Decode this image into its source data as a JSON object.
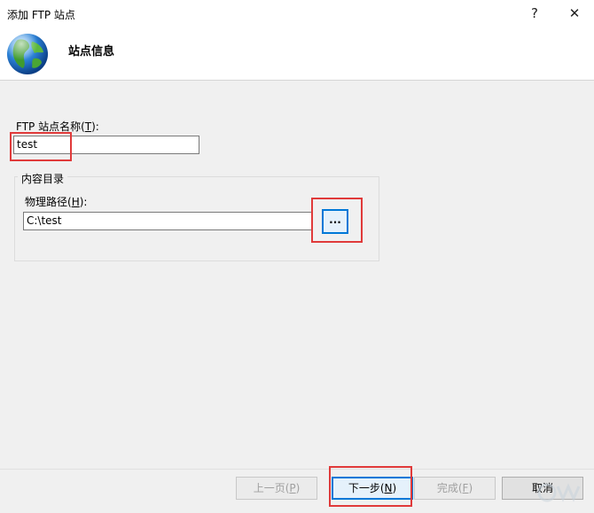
{
  "window": {
    "title": "添加 FTP 站点",
    "help_glyph": "?",
    "close_glyph": "✕"
  },
  "header": {
    "title": "站点信息",
    "icon": "globe-icon"
  },
  "site_name": {
    "label_prefix": "FTP 站点名称(",
    "label_key": "T",
    "label_suffix": "):",
    "value": "test"
  },
  "content_directory": {
    "group_label": "内容目录",
    "path_label_prefix": "物理路径(",
    "path_label_key": "H",
    "path_label_suffix": "):",
    "path_value": "C:\\test",
    "browse_label": "..."
  },
  "footer": {
    "prev": {
      "text": "上一页(",
      "key": "P",
      "end": ")"
    },
    "next": {
      "text": "下一步(",
      "key": "N",
      "end": ")"
    },
    "finish": {
      "text": "完成(",
      "key": "F",
      "end": ")"
    },
    "cancel": {
      "text": "取消"
    }
  },
  "colors": {
    "highlight": "#e03a3a",
    "focus": "#0078d7"
  }
}
